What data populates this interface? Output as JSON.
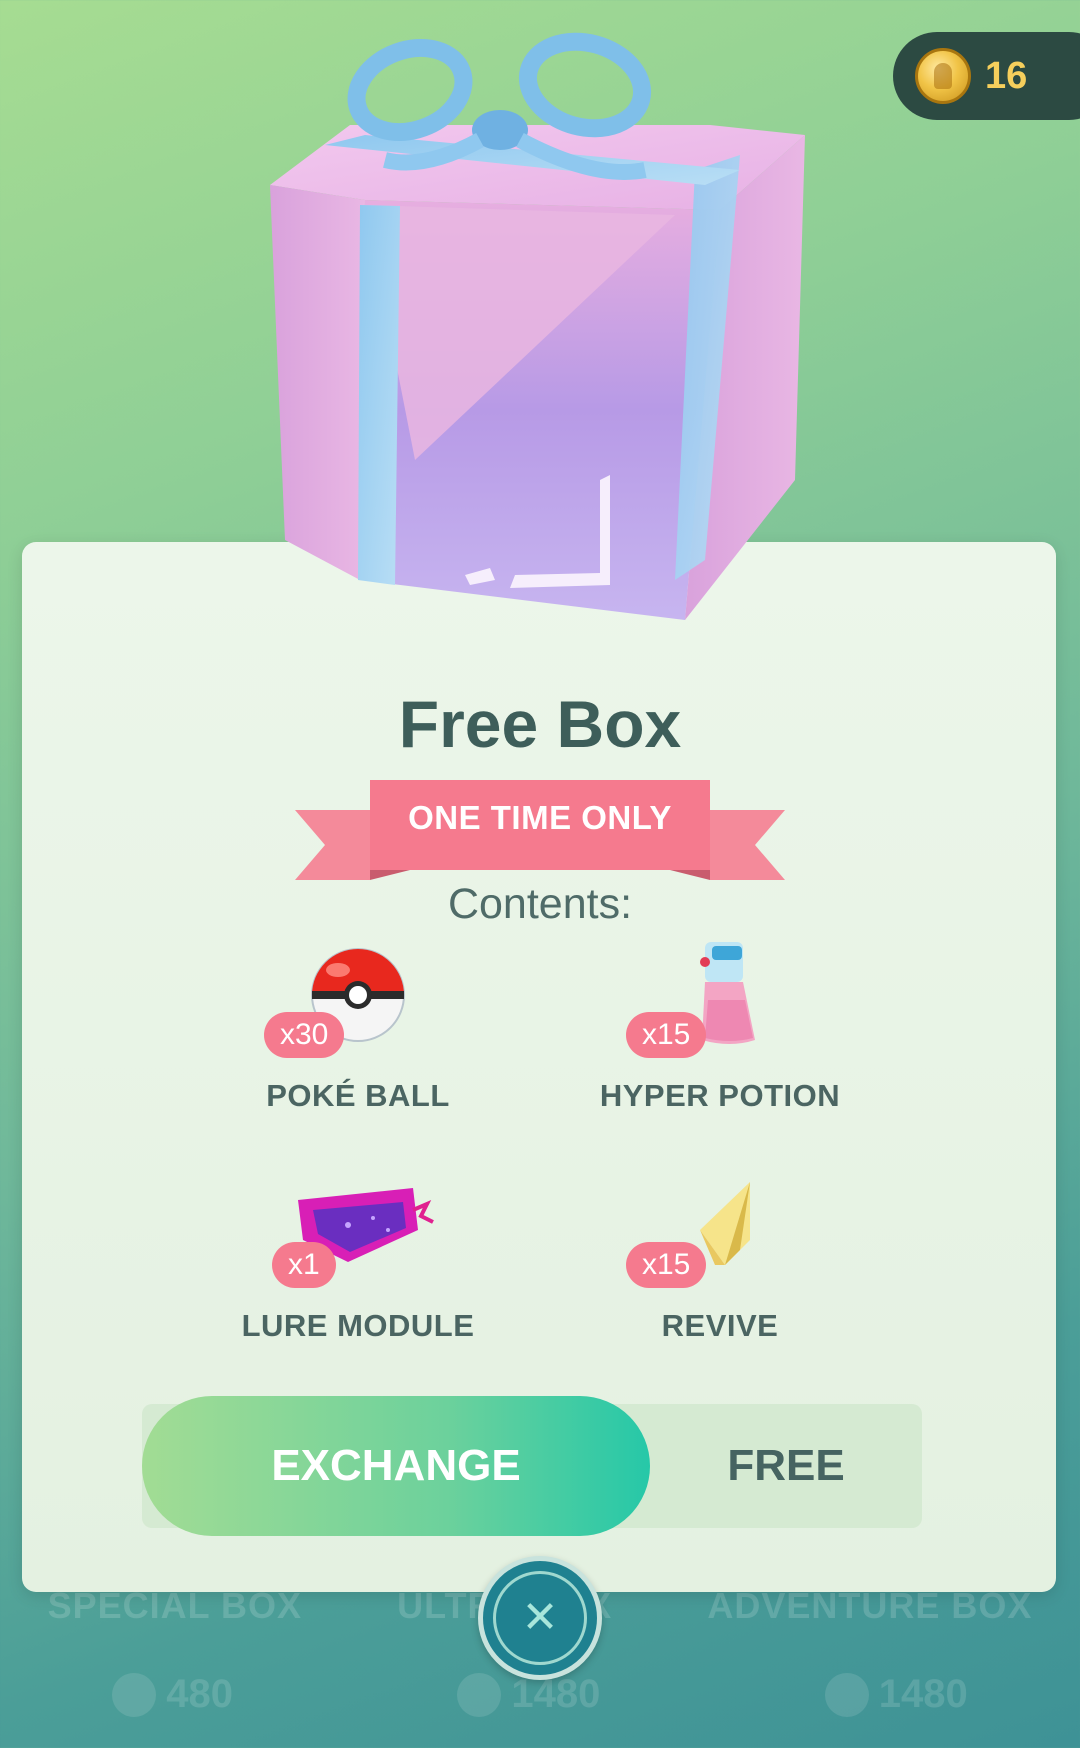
{
  "coins": {
    "count": "16"
  },
  "box": {
    "title": "Free Box",
    "banner": "ONE TIME ONLY",
    "contents_label": "Contents:",
    "items": [
      {
        "icon": "poke-ball-icon",
        "qty": "x30",
        "name": "POKÉ BALL"
      },
      {
        "icon": "hyper-potion-icon",
        "qty": "x15",
        "name": "HYPER POTION"
      },
      {
        "icon": "lure-module-icon",
        "qty": "x1",
        "name": "LURE MODULE"
      },
      {
        "icon": "revive-icon",
        "qty": "x15",
        "name": "REVIVE"
      }
    ],
    "exchange_label": "EXCHANGE",
    "price": "FREE"
  },
  "close": {
    "symbol": "✕"
  },
  "background_shop": {
    "labels": [
      "SPECIAL BOX",
      "ULTRA BOX",
      "ADVENTURE BOX"
    ],
    "prices": [
      "480",
      "1480",
      "1480"
    ]
  },
  "colors": {
    "accent_pink": "#f57a8e",
    "exchange_green": "#6cd19c",
    "close_teal": "#1f8190",
    "coin_gold": "#f6cf5c"
  }
}
